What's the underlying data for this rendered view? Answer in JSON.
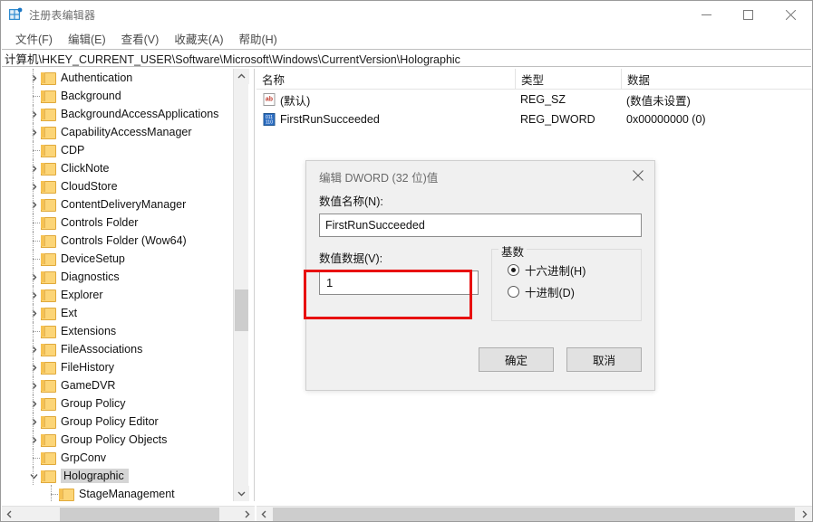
{
  "window": {
    "title": "注册表编辑器",
    "icon": "registry-icon",
    "controls": {
      "minimize": "–",
      "maximize": "□",
      "close": "✕"
    }
  },
  "menubar": {
    "items": [
      {
        "label": "文件(F)",
        "name": "menu-file"
      },
      {
        "label": "编辑(E)",
        "name": "menu-edit"
      },
      {
        "label": "查看(V)",
        "name": "menu-view"
      },
      {
        "label": "收藏夹(A)",
        "name": "menu-favorites"
      },
      {
        "label": "帮助(H)",
        "name": "menu-help"
      }
    ]
  },
  "address": {
    "path": "计算机\\HKEY_CURRENT_USER\\Software\\Microsoft\\Windows\\CurrentVersion\\Holographic"
  },
  "tree": {
    "items": [
      {
        "label": "Authentication",
        "expandable": true,
        "expanded": false,
        "selected": false,
        "indent": 0
      },
      {
        "label": "Background",
        "expandable": false,
        "expanded": false,
        "selected": false,
        "indent": 0
      },
      {
        "label": "BackgroundAccessApplications",
        "expandable": true,
        "expanded": false,
        "selected": false,
        "indent": 0
      },
      {
        "label": "CapabilityAccessManager",
        "expandable": true,
        "expanded": false,
        "selected": false,
        "indent": 0
      },
      {
        "label": "CDP",
        "expandable": false,
        "expanded": false,
        "selected": false,
        "indent": 0
      },
      {
        "label": "ClickNote",
        "expandable": true,
        "expanded": false,
        "selected": false,
        "indent": 0
      },
      {
        "label": "CloudStore",
        "expandable": true,
        "expanded": false,
        "selected": false,
        "indent": 0
      },
      {
        "label": "ContentDeliveryManager",
        "expandable": true,
        "expanded": false,
        "selected": false,
        "indent": 0
      },
      {
        "label": "Controls Folder",
        "expandable": false,
        "expanded": false,
        "selected": false,
        "indent": 0
      },
      {
        "label": "Controls Folder (Wow64)",
        "expandable": false,
        "expanded": false,
        "selected": false,
        "indent": 0
      },
      {
        "label": "DeviceSetup",
        "expandable": false,
        "expanded": false,
        "selected": false,
        "indent": 0
      },
      {
        "label": "Diagnostics",
        "expandable": true,
        "expanded": false,
        "selected": false,
        "indent": 0
      },
      {
        "label": "Explorer",
        "expandable": true,
        "expanded": false,
        "selected": false,
        "indent": 0
      },
      {
        "label": "Ext",
        "expandable": true,
        "expanded": false,
        "selected": false,
        "indent": 0
      },
      {
        "label": "Extensions",
        "expandable": false,
        "expanded": false,
        "selected": false,
        "indent": 0
      },
      {
        "label": "FileAssociations",
        "expandable": true,
        "expanded": false,
        "selected": false,
        "indent": 0
      },
      {
        "label": "FileHistory",
        "expandable": true,
        "expanded": false,
        "selected": false,
        "indent": 0
      },
      {
        "label": "GameDVR",
        "expandable": true,
        "expanded": false,
        "selected": false,
        "indent": 0
      },
      {
        "label": "Group Policy",
        "expandable": true,
        "expanded": false,
        "selected": false,
        "indent": 0
      },
      {
        "label": "Group Policy Editor",
        "expandable": true,
        "expanded": false,
        "selected": false,
        "indent": 0
      },
      {
        "label": "Group Policy Objects",
        "expandable": true,
        "expanded": false,
        "selected": false,
        "indent": 0
      },
      {
        "label": "GrpConv",
        "expandable": false,
        "expanded": false,
        "selected": false,
        "indent": 0
      },
      {
        "label": "Holographic",
        "expandable": true,
        "expanded": true,
        "selected": true,
        "indent": 0
      },
      {
        "label": "StageManagement",
        "expandable": false,
        "expanded": false,
        "selected": false,
        "indent": 1
      }
    ]
  },
  "list": {
    "columns": [
      {
        "label": "名称",
        "name": "column-name"
      },
      {
        "label": "类型",
        "name": "column-type"
      },
      {
        "label": "数据",
        "name": "column-data"
      }
    ],
    "rows": [
      {
        "icon": "string-value-icon",
        "name": "(默认)",
        "type": "REG_SZ",
        "data": "(数值未设置)"
      },
      {
        "icon": "dword-value-icon",
        "name": "FirstRunSucceeded",
        "type": "REG_DWORD",
        "data": "0x00000000 (0)"
      }
    ]
  },
  "dialog": {
    "title": "编辑 DWORD (32 位)值",
    "close_label": "✕",
    "name_label": "数值名称(N):",
    "name_value": "FirstRunSucceeded",
    "data_label": "数值数据(V):",
    "data_value": "1",
    "base_group_label": "基数",
    "radios": [
      {
        "label": "十六进制(H)",
        "checked": true,
        "name": "radio-hexadecimal"
      },
      {
        "label": "十进制(D)",
        "checked": false,
        "name": "radio-decimal"
      }
    ],
    "ok_label": "确定",
    "cancel_label": "取消"
  },
  "annotation": {
    "color": "#e81010"
  },
  "scrollbars": {
    "up_arrow": "⌃",
    "down_arrow": "⌄",
    "left_arrow": "❮",
    "right_arrow": "❯"
  }
}
